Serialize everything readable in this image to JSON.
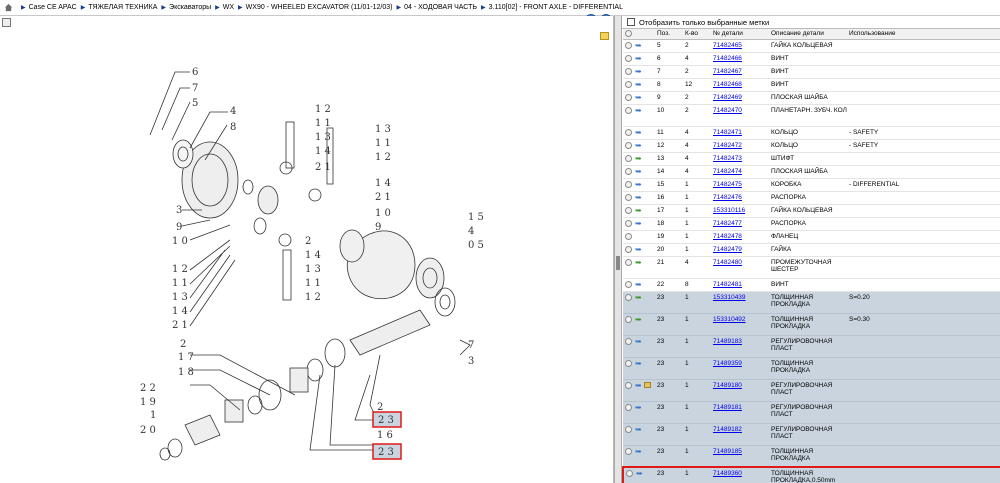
{
  "breadcrumbs": [
    "Case CE APAC",
    "ТЯЖЕЛАЯ ТЕХНИКА",
    "Экскаваторы",
    "WX",
    "WX90 - WHEELED EXCAVATOR (11/01-12/03)",
    "04 - ХОДОВАЯ ЧАСТЬ",
    "3.110[02] - FRONT AXLE - DIFFERENTIAL"
  ],
  "filter_label": "Отобразить только выбранные метки",
  "columns": {
    "pos": "Поз.",
    "qty": "К-во",
    "part": "№ детали",
    "desc": "Описание детали",
    "usage": "Использование"
  },
  "rows": [
    {
      "pos": "5",
      "qty": "2",
      "part": "71482465",
      "desc": "ГАЙКА КОЛЬЦЕВАЯ",
      "usage": "",
      "arrow": "blue"
    },
    {
      "pos": "6",
      "qty": "4",
      "part": "71482466",
      "desc": "ВИНТ",
      "usage": "",
      "arrow": "blue"
    },
    {
      "pos": "7",
      "qty": "2",
      "part": "71482467",
      "desc": "ВИНТ",
      "usage": "",
      "arrow": "blue"
    },
    {
      "pos": "8",
      "qty": "12",
      "part": "71482468",
      "desc": "ВИНТ",
      "usage": "",
      "arrow": "blue"
    },
    {
      "pos": "9",
      "qty": "2",
      "part": "71482469",
      "desc": "ПЛОСКАЯ ШАЙБА",
      "usage": "",
      "arrow": "blue"
    },
    {
      "pos": "10",
      "qty": "2",
      "part": "71482470",
      "desc": "ПЛАНЕТАРН. ЗУБЧ. КОЛ",
      "usage": "",
      "arrow": "blue"
    },
    {
      "pos": "11",
      "qty": "4",
      "part": "71482471",
      "desc": "КОЛЬЦО",
      "usage": "- SAFETY",
      "arrow": "blue"
    },
    {
      "pos": "12",
      "qty": "4",
      "part": "71482472",
      "desc": "КОЛЬЦО",
      "usage": "- SAFETY",
      "arrow": "blue"
    },
    {
      "pos": "13",
      "qty": "4",
      "part": "71482473",
      "desc": "ШТИФТ",
      "usage": "",
      "arrow": "green"
    },
    {
      "pos": "14",
      "qty": "4",
      "part": "71482474",
      "desc": "ПЛОСКАЯ ШАЙБА",
      "usage": "",
      "arrow": "blue"
    },
    {
      "pos": "15",
      "qty": "1",
      "part": "71482475",
      "desc": "КОРОБКА",
      "usage": "- DIFFERENTIAL",
      "arrow": "blue"
    },
    {
      "pos": "16",
      "qty": "1",
      "part": "71482476",
      "desc": "РАСПОРКА",
      "usage": "",
      "arrow": "blue"
    },
    {
      "pos": "17",
      "qty": "1",
      "part": "153310116",
      "desc": "ГАЙКА КОЛЬЦЕВАЯ",
      "usage": "",
      "arrow": "green"
    },
    {
      "pos": "18",
      "qty": "1",
      "part": "71482477",
      "desc": "РАСПОРКА",
      "usage": "",
      "arrow": "blue"
    },
    {
      "pos": "19",
      "qty": "1",
      "part": "71482478",
      "desc": "ФЛАНЕЦ",
      "usage": "",
      "arrow": ""
    },
    {
      "pos": "20",
      "qty": "1",
      "part": "71482479",
      "desc": "ГАЙКА",
      "usage": "",
      "arrow": "blue"
    },
    {
      "pos": "21",
      "qty": "4",
      "part": "71482480",
      "desc": "ПРОМЕЖУТОЧНАЯ ШЕСТЕР",
      "usage": "",
      "arrow": "green"
    },
    {
      "pos": "22",
      "qty": "8",
      "part": "71482481",
      "desc": "ВИНТ",
      "usage": "",
      "arrow": "blue"
    },
    {
      "pos": "23",
      "qty": "1",
      "part": "153310439",
      "desc": "ТОЛЩИННАЯ ПРОКЛАДКА",
      "usage": "S=0.20",
      "arrow": "green",
      "sel": true
    },
    {
      "pos": "23",
      "qty": "1",
      "part": "153310492",
      "desc": "ТОЛЩИННАЯ ПРОКЛАДКА",
      "usage": "S=0.30",
      "arrow": "green",
      "sel": true
    },
    {
      "pos": "23",
      "qty": "1",
      "part": "71489183",
      "desc": "РЕГУЛИРОВОЧНАЯ ПЛАСТ",
      "usage": "",
      "arrow": "blue",
      "sel": true
    },
    {
      "pos": "23",
      "qty": "1",
      "part": "71489359",
      "desc": "ТОЛЩИННАЯ ПРОКЛАДКА",
      "usage": "",
      "arrow": "blue",
      "sel": true
    },
    {
      "pos": "23",
      "qty": "1",
      "part": "71489180",
      "desc": "РЕГУЛИРОВОЧНАЯ ПЛАСТ",
      "usage": "",
      "arrow": "blue",
      "pkg": true,
      "sel": true
    },
    {
      "pos": "23",
      "qty": "1",
      "part": "71489181",
      "desc": "РЕГУЛИРОВОЧНАЯ ПЛАСТ",
      "usage": "",
      "arrow": "blue",
      "sel": true
    },
    {
      "pos": "23",
      "qty": "1",
      "part": "71489182",
      "desc": "РЕГУЛИРОВОЧНАЯ ПЛАСТ",
      "usage": "",
      "arrow": "blue",
      "sel": true
    },
    {
      "pos": "23",
      "qty": "1",
      "part": "71489185",
      "desc": "ТОЛЩИННАЯ ПРОКЛАДКА",
      "usage": "",
      "arrow": "blue",
      "sel": true
    },
    {
      "pos": "23",
      "qty": "1",
      "part": "71489360",
      "desc": "ТОЛЩИННАЯ ПРОКЛАДКА,0.50mm Thk",
      "usage": "",
      "arrow": "blue",
      "sel": true,
      "hl": true
    }
  ],
  "callouts": [
    "6",
    "7",
    "5",
    "4",
    "8",
    "3",
    "9",
    "10",
    "12",
    "11",
    "13",
    "14",
    "21",
    "2",
    "17",
    "18",
    "22",
    "19",
    "1",
    "20",
    "2",
    "23",
    "16",
    "23",
    "12",
    "11",
    "13",
    "14",
    "21",
    "13",
    "11",
    "12",
    "14",
    "21",
    "10",
    "9",
    "2",
    "14",
    "13",
    "11",
    "12",
    "15",
    "4",
    "05",
    "7",
    "3"
  ]
}
